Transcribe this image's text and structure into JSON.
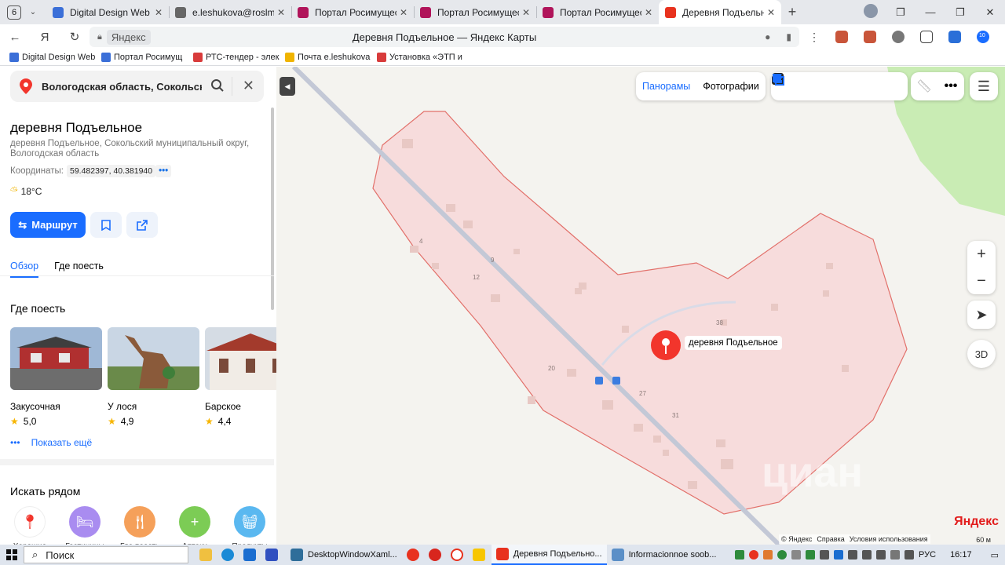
{
  "browser": {
    "tab_count": "6",
    "tabs": [
      {
        "title": "Digital Design Web Clie",
        "color": "#3b6fd8"
      },
      {
        "title": "e.leshukova@roslm.gov",
        "color": "#666666"
      },
      {
        "title": "Портал Росимущества",
        "color": "#b0145a"
      },
      {
        "title": "Портал Росимущества",
        "color": "#b0145a"
      },
      {
        "title": "Портал Росимущества",
        "color": "#b0145a"
      },
      {
        "title": "Деревня Подъельное",
        "color": "#e8321e"
      }
    ],
    "omnibox_host": "Яндекс",
    "page_title": "Деревня Подъельное — Яндекс Карты",
    "bookmarks": [
      {
        "label": "Digital Design Web",
        "color": "#3b6fd8"
      },
      {
        "label": "Портал Росимущ",
        "color": "#3b6fd8"
      },
      {
        "label": "РТС-тендер - элек",
        "color": "#d83b3b"
      },
      {
        "label": "Почта e.leshukova",
        "color": "#f0b400"
      },
      {
        "label": "Установка «ЭТП и",
        "color": "#d83b3b"
      }
    ],
    "notif_badge": "10"
  },
  "panel": {
    "search_query": "Вологодская область, Сокольский ра",
    "place_title": "деревня Подъельное",
    "place_address": "деревня Подъельное, Сокольский муниципальный округ, Вологодская область",
    "coords_label": "Координаты:",
    "coords_value": "59.482397, 40.381940",
    "coords_more": "•••",
    "weather": "18°C",
    "route_label": "Маршрут",
    "tabs": [
      "Обзор",
      "Где поесть"
    ],
    "where_to_eat": "Где поесть",
    "places": [
      {
        "name": "Закусочная",
        "rating": "5,0"
      },
      {
        "name": "У лося",
        "rating": "4,9"
      },
      {
        "name": "Барское",
        "rating": "4,4"
      }
    ],
    "show_more": "Показать ещё",
    "more_dots": "•••",
    "search_nearby": "Искать рядом",
    "nearby": [
      {
        "label": "Хорошие",
        "color": "#ffffff",
        "icon": "pin-icon"
      },
      {
        "label": "Гостиницы",
        "color": "#a98cf0",
        "icon": "bed-icon"
      },
      {
        "label": "Где поесть",
        "color": "#f5a05a",
        "icon": "fork-icon"
      },
      {
        "label": "Аптеки",
        "color": "#7ccc55",
        "icon": "plus-icon"
      },
      {
        "label": "Продукты",
        "color": "#5ab8f0",
        "icon": "basket-icon"
      }
    ]
  },
  "map": {
    "panoramas": "Панорамы",
    "photos": "Фотографии",
    "marker_label": "деревня Подъельное",
    "btn_3d": "3D",
    "logo": "Яндекс",
    "footer": [
      "© Яндекс",
      "Справка",
      "Условия использования"
    ],
    "scale": "60 м",
    "watermark": "циан",
    "house_numbers": [
      {
        "n": "4"
      },
      {
        "n": "9"
      },
      {
        "n": "12"
      },
      {
        "n": "20"
      },
      {
        "n": "27"
      },
      {
        "n": "31"
      },
      {
        "n": "38"
      }
    ]
  },
  "taskbar": {
    "search": "Поиск",
    "apps": [
      {
        "label": "DesktopWindowXaml..."
      },
      {
        "label": "Деревня Подъельно..."
      },
      {
        "label": "Informacionnoe soob..."
      }
    ],
    "lang": "РУС",
    "time": "16:17"
  }
}
